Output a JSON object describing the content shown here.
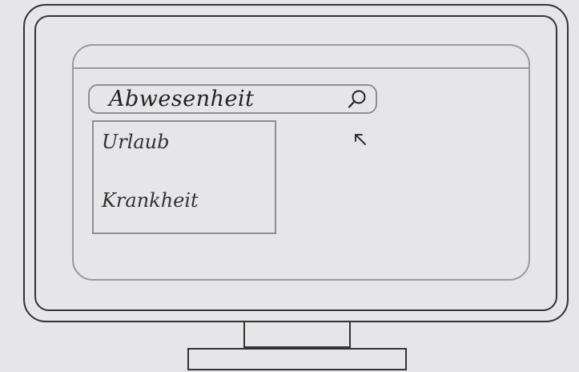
{
  "search": {
    "value": "Abwesenheit",
    "icon": "search-icon"
  },
  "dropdown": {
    "items": [
      {
        "label": "Urlaub"
      },
      {
        "label": "Krankheit"
      }
    ]
  },
  "cursor": {
    "icon": "mouse-pointer-icon"
  },
  "colors": {
    "background": "#e6e6e8",
    "monitor_stroke": "#333333",
    "window_stroke": "#9a9a9a"
  }
}
